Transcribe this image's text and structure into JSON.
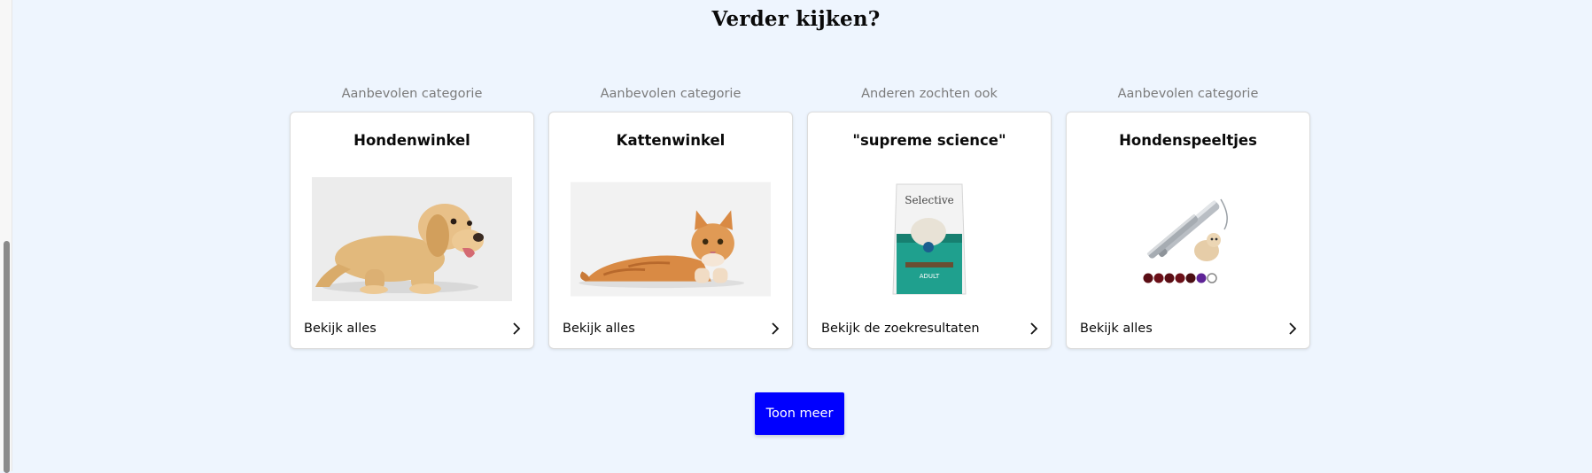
{
  "section": {
    "title": "Verder kijken?"
  },
  "cards": [
    {
      "caption": "Aanbevolen categorie",
      "title": "Hondenwinkel",
      "image": "labrador-puppy",
      "link": "Bekijk alles"
    },
    {
      "caption": "Aanbevolen categorie",
      "title": "Kattenwinkel",
      "image": "ginger-cat",
      "link": "Bekijk alles"
    },
    {
      "caption": "Anderen zochten ook",
      "title": "\"supreme science\"",
      "image": "selective-food-bag",
      "bag_brand": "Selective",
      "bag_label": "ADULT",
      "link": "Bekijk de zoekresultaten"
    },
    {
      "caption": "Aanbevolen categorie",
      "title": "Hondenspeeltjes",
      "image": "laser-pointer-toy",
      "link": "Bekijk alles"
    }
  ],
  "actions": {
    "show_more": "Toon meer"
  },
  "colors": {
    "page_background": "#eef5fe",
    "primary_button": "#0000ff",
    "card_background": "#ffffff",
    "caption_text": "#7b7b7b"
  },
  "icons": {
    "card_link": "chevron-right-icon"
  }
}
